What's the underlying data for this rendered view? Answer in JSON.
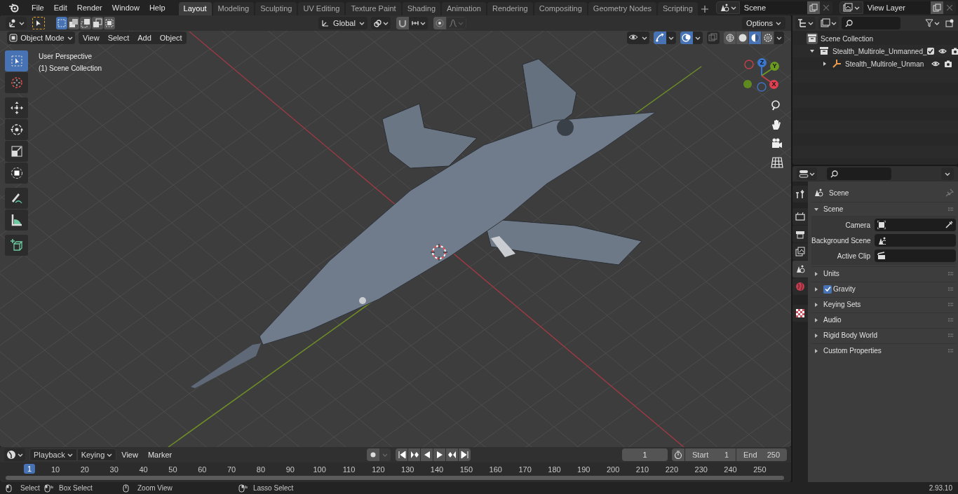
{
  "menu_bar": {
    "items": [
      "File",
      "Edit",
      "Render",
      "Window",
      "Help"
    ]
  },
  "workspace_tabs": [
    {
      "label": "Layout",
      "selected": true
    },
    {
      "label": "Modeling",
      "selected": false
    },
    {
      "label": "Sculpting",
      "selected": false
    },
    {
      "label": "UV Editing",
      "selected": false
    },
    {
      "label": "Texture Paint",
      "selected": false
    },
    {
      "label": "Shading",
      "selected": false
    },
    {
      "label": "Animation",
      "selected": false
    },
    {
      "label": "Rendering",
      "selected": false
    },
    {
      "label": "Compositing",
      "selected": false
    },
    {
      "label": "Geometry Nodes",
      "selected": false
    },
    {
      "label": "Scripting",
      "selected": false
    }
  ],
  "scene_selector": {
    "value": "Scene"
  },
  "view_layer_selector": {
    "value": "View Layer"
  },
  "viewport": {
    "header": {
      "select_modes": [
        {
          "selected": true
        },
        {
          "selected": false
        },
        {
          "selected": false
        },
        {
          "selected": false
        },
        {
          "selected": false
        }
      ],
      "transform_orientation": "Global",
      "options_label": "Options",
      "mode": "Object Mode",
      "menus": [
        "View",
        "Select",
        "Add",
        "Object"
      ],
      "toggles": [
        {
          "kind": "visibility",
          "on": false
        },
        {
          "kind": "gizmo",
          "on": true
        },
        {
          "kind": "overlay",
          "on": true
        },
        {
          "kind": "xray",
          "on": false
        }
      ],
      "shading_modes": [
        {
          "kind": "wireframe",
          "selected": false
        },
        {
          "kind": "solid",
          "selected": false
        },
        {
          "kind": "material",
          "selected": true
        },
        {
          "kind": "rendered",
          "selected": false
        }
      ]
    },
    "overlay_text": [
      "User Perspective",
      "(1) Scene Collection"
    ],
    "tools": [
      {
        "kind": "select",
        "selected": true
      },
      {
        "kind": "cursor",
        "selected": false
      },
      {
        "kind": "move",
        "selected": false
      },
      {
        "kind": "rotate",
        "selected": false
      },
      {
        "kind": "scale",
        "selected": false
      },
      {
        "kind": "transform",
        "selected": false
      },
      {
        "kind": "annotate",
        "selected": false
      },
      {
        "kind": "measure",
        "selected": false
      },
      {
        "kind": "add_cube",
        "selected": false
      }
    ],
    "gizmo_axes": [
      "Z",
      "Y",
      "X"
    ]
  },
  "outliner": {
    "root": "Scene Collection",
    "items": [
      {
        "label": "Stealth_Multirole_Unmanned_",
        "kind": "collection",
        "expanded": true,
        "checked": true,
        "children": [
          {
            "label": "Stealth_Multirole_Unman",
            "kind": "object",
            "expanded": false
          }
        ]
      }
    ]
  },
  "properties": {
    "tabs": [
      {
        "kind": "tool",
        "selected": false
      },
      {
        "kind": "render",
        "selected": false
      },
      {
        "kind": "output",
        "selected": false
      },
      {
        "kind": "view_layer",
        "selected": false
      },
      {
        "kind": "scene",
        "selected": true
      },
      {
        "kind": "world",
        "selected": false
      },
      {
        "kind": "texture",
        "selected": false
      }
    ],
    "context": "Scene",
    "panels": [
      {
        "title": "Scene",
        "expanded": true,
        "fields": [
          {
            "label": "Camera",
            "kind": "camera"
          },
          {
            "label": "Background Scene",
            "kind": "scene"
          },
          {
            "label": "Active Clip",
            "kind": "clip"
          }
        ]
      },
      {
        "title": "Units",
        "expanded": false
      },
      {
        "title": "Gravity",
        "expanded": false,
        "checked": true
      },
      {
        "title": "Keying Sets",
        "expanded": false
      },
      {
        "title": "Audio",
        "expanded": false
      },
      {
        "title": "Rigid Body World",
        "expanded": false
      },
      {
        "title": "Custom Properties",
        "expanded": false
      }
    ]
  },
  "timeline": {
    "menus": [
      "Playback",
      "Keying",
      "View",
      "Marker"
    ],
    "current_frame": "1",
    "start_label": "Start",
    "start": "1",
    "end_label": "End",
    "end": "250",
    "ruler": [
      "1",
      "10",
      "20",
      "30",
      "40",
      "50",
      "60",
      "70",
      "80",
      "90",
      "100",
      "110",
      "120",
      "130",
      "140",
      "150",
      "160",
      "170",
      "180",
      "190",
      "200",
      "210",
      "220",
      "230",
      "240",
      "250"
    ]
  },
  "status_bar": {
    "hints": [
      "Select",
      "Box Select",
      "Zoom View",
      "Lasso Select"
    ],
    "version": "2.93.10"
  }
}
